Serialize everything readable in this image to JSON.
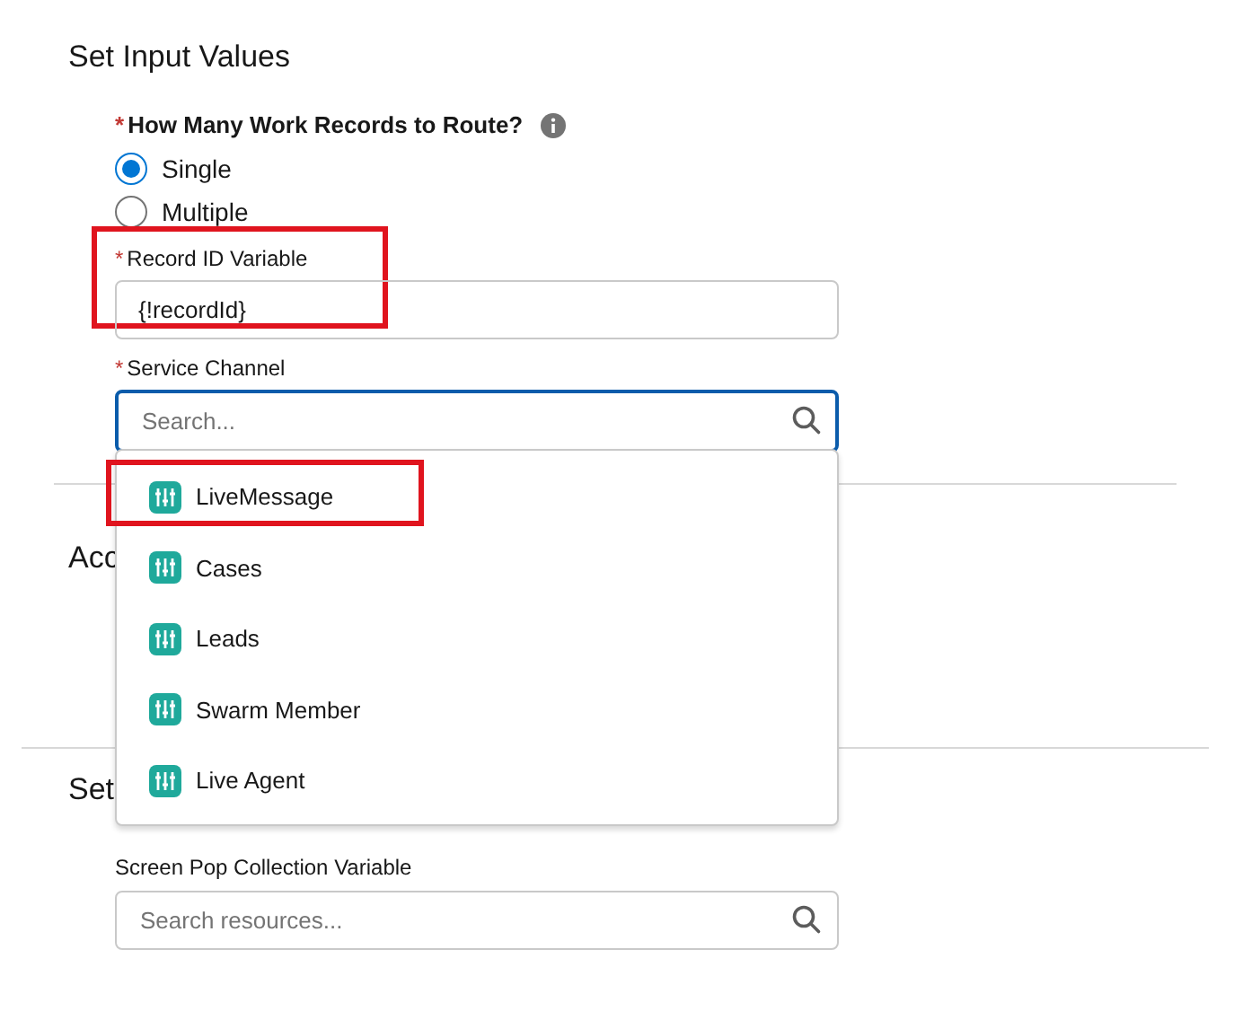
{
  "sections": [
    {
      "heading": "Set Input Values"
    },
    {
      "heading": "Acc"
    },
    {
      "heading": "Set"
    }
  ],
  "work_records": {
    "label": "How Many Work Records to Route?",
    "required_mark": "*",
    "options": [
      {
        "label": "Single",
        "selected": true
      },
      {
        "label": "Multiple",
        "selected": false
      }
    ]
  },
  "record_id": {
    "label": "Record ID Variable",
    "required_mark": "*",
    "value": "{!recordId}",
    "highlighted": true
  },
  "service_channel": {
    "label": "Service Channel",
    "required_mark": "*",
    "placeholder": "Search...",
    "focused": true,
    "options": [
      {
        "label": "LiveMessage",
        "highlighted": true
      },
      {
        "label": "Cases",
        "highlighted": false
      },
      {
        "label": "Leads",
        "highlighted": false
      },
      {
        "label": "Swarm Member",
        "highlighted": false
      },
      {
        "label": "Live Agent",
        "highlighted": false
      }
    ]
  },
  "screen_pop": {
    "label": "Screen Pop Collection Variable",
    "placeholder": "Search resources..."
  }
}
